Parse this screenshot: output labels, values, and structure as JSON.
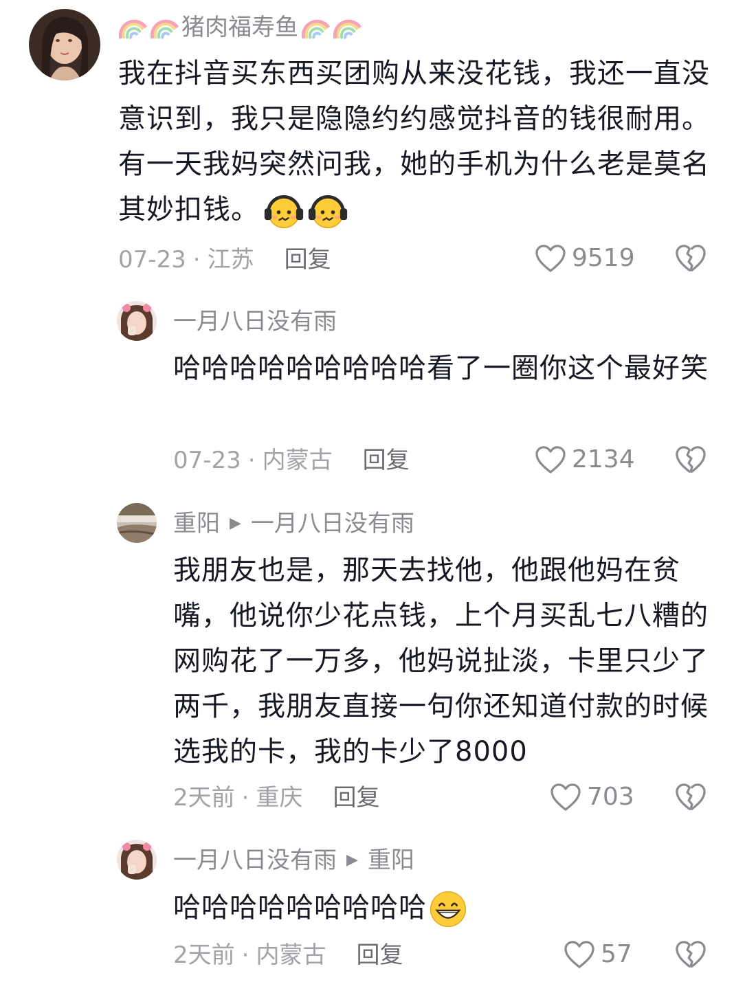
{
  "comments": [
    {
      "username": "猪肉福寿鱼",
      "text": "我在抖音买东西买团购从来没花钱，我还一直没意识到，我只是隐隐约约感觉抖音的钱很耐用。有一天我妈突然问我，她的手机为什么老是莫名其妙扣钱。",
      "emojis": [
        "headphone-face-emoji",
        "headphone-face-emoji"
      ],
      "date": "07-23",
      "location": "江苏",
      "reply_label": "回复",
      "likes": "9519"
    },
    {
      "username": "一月八日没有雨",
      "text": "哈哈哈哈哈哈哈哈哈看了一圈你这个最好笑",
      "date": "07-23",
      "location": "内蒙古",
      "reply_label": "回复",
      "likes": "2134"
    },
    {
      "username": "重阳",
      "reply_to": "一月八日没有雨",
      "text": "我朋友也是，那天去找他，他跟他妈在贫嘴，他说你少花点钱，上个月买乱七八糟的网购花了一万多，他妈说扯淡，卡里只少了两千，我朋友直接一句你还知道付款的时候选我的卡，我的卡少了8000",
      "date": "2天前",
      "location": "重庆",
      "reply_label": "回复",
      "likes": "703"
    },
    {
      "username": "一月八日没有雨",
      "reply_to": "重阳",
      "text": "哈哈哈哈哈哈哈哈哈",
      "emojis": [
        "grin-emoji"
      ],
      "date": "2天前",
      "location": "内蒙古",
      "reply_label": "回复",
      "likes": "57"
    }
  ],
  "meta_separator": "·",
  "colors": {
    "text": "#161823",
    "secondary": "#8a8b91",
    "meta": "#a2a3a8"
  }
}
